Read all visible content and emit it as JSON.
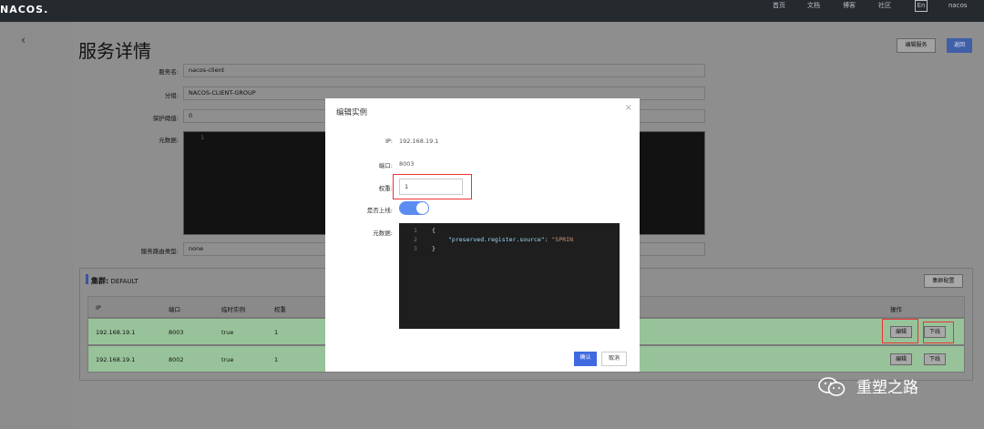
{
  "topbar": {
    "logo": "NACOS.",
    "nav": [
      "首页",
      "文档",
      "博客",
      "社区"
    ],
    "lang": "En",
    "user": "nacos"
  },
  "page": {
    "back_icon": "‹",
    "title": "服务详情",
    "edit_service_label": "编辑服务",
    "return_label": "返回"
  },
  "form": {
    "service_name_label": "服务名:",
    "service_name": "nacos-client",
    "group_label": "分组:",
    "group": "NACOS-CLIENT-GROUP",
    "protect_threshold_label": "保护阈值:",
    "protect_threshold": "0",
    "metadata_label": "元数据:",
    "metadata_line_no": "1",
    "route_type_label": "服务路由类型:",
    "route_type": "none"
  },
  "cluster": {
    "title": "集群:",
    "name": "DEFAULT",
    "config_label": "集群配置",
    "columns": [
      "IP",
      "端口",
      "临时实例",
      "权重",
      "操作"
    ],
    "rows": [
      {
        "ip": "192.168.19.1",
        "port": "8003",
        "ephemeral": "true",
        "weight": "1",
        "edit": "编辑",
        "offline": "下线"
      },
      {
        "ip": "192.168.19.1",
        "port": "8002",
        "ephemeral": "true",
        "weight": "1",
        "edit": "编辑",
        "offline": "下线"
      }
    ]
  },
  "modal": {
    "title": "编辑实例",
    "close_icon": "×",
    "ip_label": "IP:",
    "ip": "192.168.19.1",
    "port_label": "端口:",
    "port": "8003",
    "weight_label": "权重:",
    "weight": "1",
    "online_label": "是否上线:",
    "online": true,
    "metadata_label": "元数据:",
    "code_lines": [
      "1",
      "2",
      "3"
    ],
    "code_open": "{",
    "code_key": "\"preserved.register.source\"",
    "code_colon": ": ",
    "code_value": "\"SPRIN",
    "code_close": "}",
    "confirm_label": "确认",
    "cancel_label": "取消"
  },
  "watermark": {
    "text": "重塑之路"
  },
  "colors": {
    "topbar": "#252a2f",
    "accent": "#3f6ae0",
    "row_highlight": "#98c299",
    "highlight_box": "#e33333"
  }
}
